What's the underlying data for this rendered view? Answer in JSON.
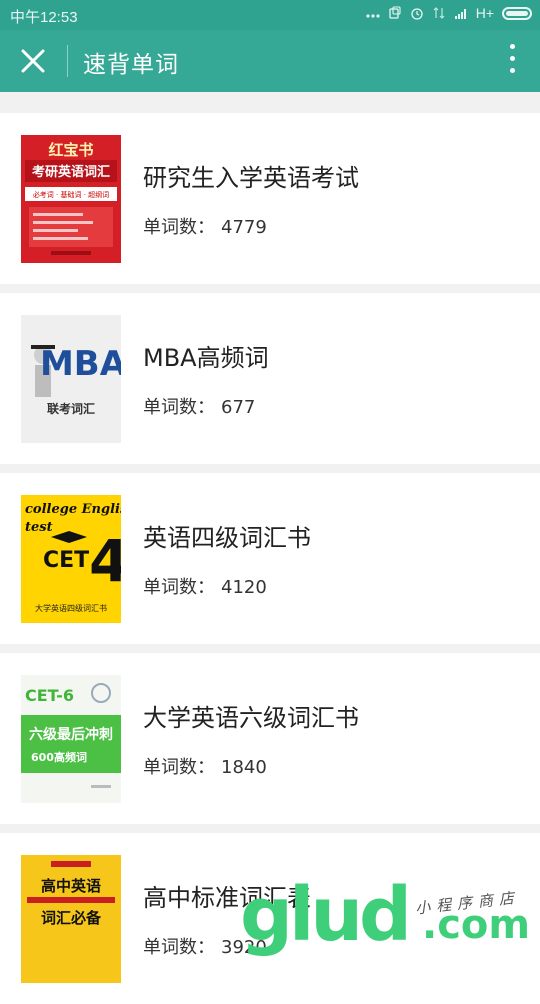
{
  "status_bar": {
    "time": "中午12:53",
    "network": "H+"
  },
  "app_bar": {
    "title": "速背单词"
  },
  "books": [
    {
      "title": "研究生入学英语考试",
      "count_label": "单词数：",
      "count": "4779"
    },
    {
      "title": "MBA高频词",
      "count_label": "单词数：",
      "count": "677"
    },
    {
      "title": "英语四级词汇书",
      "count_label": "单词数：",
      "count": "4120"
    },
    {
      "title": "大学英语六级词汇书",
      "count_label": "单词数：",
      "count": "1840"
    },
    {
      "title": "高中标准词汇表",
      "count_label": "单词数：",
      "count": "3920"
    }
  ],
  "covers": {
    "book1": {
      "top": "红宝书",
      "sub": "考研英语词汇",
      "line": "必考词 · 基础词 · 超纲词"
    },
    "book2": {
      "main": "MBA",
      "sub": "联考词汇"
    },
    "book3": {
      "line1": "college English",
      "line2": "test",
      "badge": "CET",
      "num": "4",
      "sub": "大学英语四级词汇书"
    },
    "book4": {
      "badge": "CET-6",
      "line1": "六级最后冲刺",
      "line2": "600高频词"
    },
    "book5": {
      "line1": "高中英语",
      "line2": "词汇必备"
    }
  },
  "watermark": {
    "logo": "glud",
    "domain": ".com",
    "tagline": "小程序商店"
  },
  "colors": {
    "status_bar": "#2fa38f",
    "app_bar": "#35a996",
    "background": "#f1f1f1"
  }
}
